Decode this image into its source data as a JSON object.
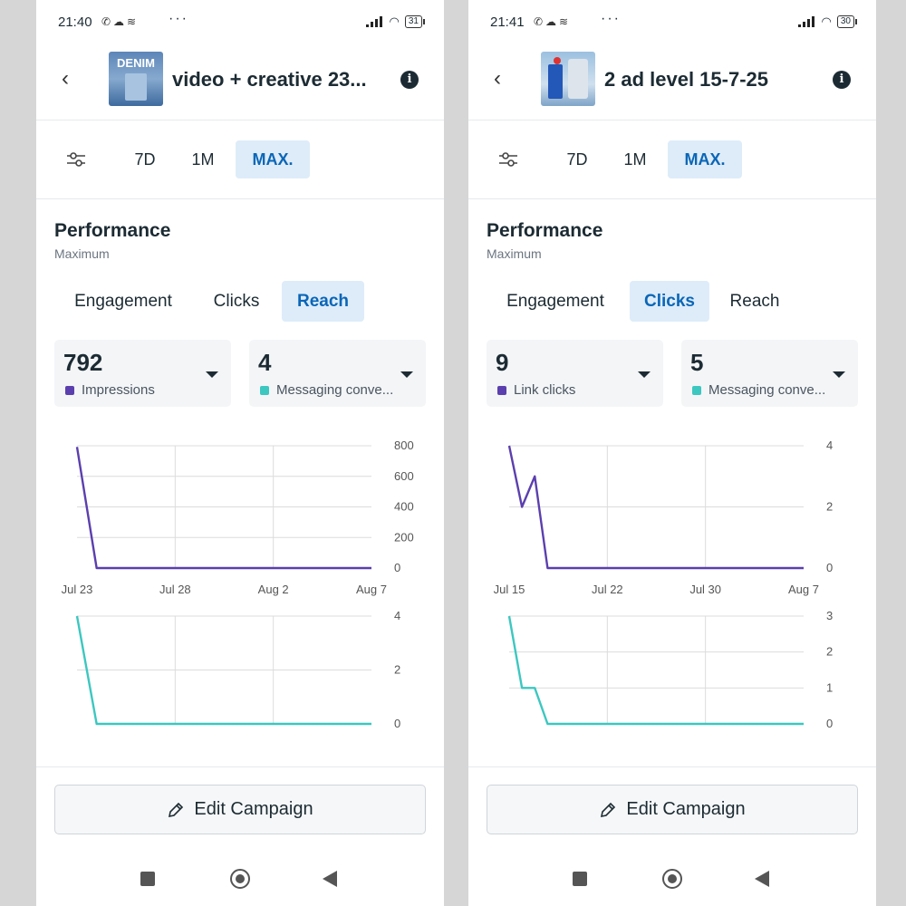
{
  "colors": {
    "impressions": "#5b3fae",
    "messaging": "#3cc7c0",
    "accent": "#0a66b7",
    "active_bg": "#deecf9"
  },
  "icons": {
    "back": "chevron-left-icon",
    "info": "info-icon",
    "filter": "sliders-icon",
    "edit": "pencil-icon"
  },
  "phones": [
    {
      "status": {
        "time": "21:40",
        "battery": "31"
      },
      "header": {
        "title": "video + creative 23...",
        "thumbnail_label": "DENIM"
      },
      "range": {
        "options": [
          "7D",
          "1M",
          "MAX."
        ],
        "selected": "MAX."
      },
      "performance": {
        "title": "Performance",
        "subtitle": "Maximum"
      },
      "metric_tabs": [
        "Engagement",
        "Clicks",
        "Reach"
      ],
      "active_metric": "Reach",
      "cards": [
        {
          "value": "792",
          "label": "Impressions"
        },
        {
          "value": "4",
          "label": "Messaging conve..."
        }
      ],
      "edit_label": "Edit Campaign",
      "chart_data": [
        {
          "type": "line",
          "x": [
            "Jul 23",
            "Jul 24",
            "Jul 25",
            "Jul 26",
            "Jul 27",
            "Jul 28",
            "Jul 29",
            "Jul 30",
            "Jul 31",
            "Aug 1",
            "Aug 2",
            "Aug 3",
            "Aug 4",
            "Aug 5",
            "Aug 6",
            "Aug 7"
          ],
          "x_ticks": [
            "Jul 23",
            "Jul 28",
            "Aug 2",
            "Aug 7"
          ],
          "series": [
            {
              "values": [
                792,
                0,
                0,
                0,
                0,
                0,
                0,
                0,
                0,
                0,
                0,
                0,
                0,
                0,
                0,
                0
              ]
            }
          ],
          "y_ticks": [
            "800",
            "600",
            "400",
            "200",
            "0"
          ],
          "ylim": [
            0,
            800
          ]
        },
        {
          "type": "line",
          "x": [
            "Jul 23",
            "Jul 24",
            "Jul 25",
            "Jul 26",
            "Jul 27",
            "Jul 28",
            "Jul 29",
            "Jul 30",
            "Jul 31",
            "Aug 1",
            "Aug 2",
            "Aug 3",
            "Aug 4",
            "Aug 5",
            "Aug 6",
            "Aug 7"
          ],
          "series": [
            {
              "values": [
                4,
                0,
                0,
                0,
                0,
                0,
                0,
                0,
                0,
                0,
                0,
                0,
                0,
                0,
                0,
                0
              ]
            }
          ],
          "y_ticks": [
            "4",
            "2",
            "0"
          ],
          "ylim": [
            0,
            4
          ]
        }
      ]
    },
    {
      "status": {
        "time": "21:41",
        "battery": "30"
      },
      "header": {
        "title": "2 ad level 15-7-25",
        "thumbnail_label": ""
      },
      "range": {
        "options": [
          "7D",
          "1M",
          "MAX."
        ],
        "selected": "MAX."
      },
      "performance": {
        "title": "Performance",
        "subtitle": "Maximum"
      },
      "metric_tabs": [
        "Engagement",
        "Clicks",
        "Reach"
      ],
      "active_metric": "Clicks",
      "cards": [
        {
          "value": "9",
          "label": "Link clicks"
        },
        {
          "value": "5",
          "label": "Messaging conve..."
        }
      ],
      "edit_label": "Edit Campaign",
      "chart_data": [
        {
          "type": "line",
          "x": [
            "Jul 15",
            "Jul 16",
            "Jul 17",
            "Jul 18",
            "Jul 19",
            "Jul 20",
            "Jul 21",
            "Jul 22",
            "Jul 23",
            "Jul 24",
            "Jul 25",
            "Jul 26",
            "Jul 27",
            "Jul 28",
            "Jul 29",
            "Jul 30",
            "Jul 31",
            "Aug 1",
            "Aug 2",
            "Aug 3",
            "Aug 4",
            "Aug 5",
            "Aug 6",
            "Aug 7"
          ],
          "x_ticks": [
            "Jul 15",
            "Jul 22",
            "Jul 30",
            "Aug 7"
          ],
          "series": [
            {
              "values": [
                4,
                2,
                3,
                0,
                0,
                0,
                0,
                0,
                0,
                0,
                0,
                0,
                0,
                0,
                0,
                0,
                0,
                0,
                0,
                0,
                0,
                0,
                0,
                0
              ]
            }
          ],
          "y_ticks": [
            "4",
            "2",
            "0"
          ],
          "ylim": [
            0,
            4
          ]
        },
        {
          "type": "line",
          "x": [
            "Jul 15",
            "Jul 16",
            "Jul 17",
            "Jul 18",
            "Jul 19",
            "Jul 20",
            "Jul 21",
            "Jul 22",
            "Jul 23",
            "Jul 24",
            "Jul 25",
            "Jul 26",
            "Jul 27",
            "Jul 28",
            "Jul 29",
            "Jul 30",
            "Jul 31",
            "Aug 1",
            "Aug 2",
            "Aug 3",
            "Aug 4",
            "Aug 5",
            "Aug 6",
            "Aug 7"
          ],
          "series": [
            {
              "values": [
                3,
                1,
                1,
                0,
                0,
                0,
                0,
                0,
                0,
                0,
                0,
                0,
                0,
                0,
                0,
                0,
                0,
                0,
                0,
                0,
                0,
                0,
                0,
                0
              ]
            }
          ],
          "y_ticks": [
            "3",
            "2",
            "1",
            "0"
          ],
          "ylim": [
            0,
            3
          ]
        }
      ]
    }
  ]
}
